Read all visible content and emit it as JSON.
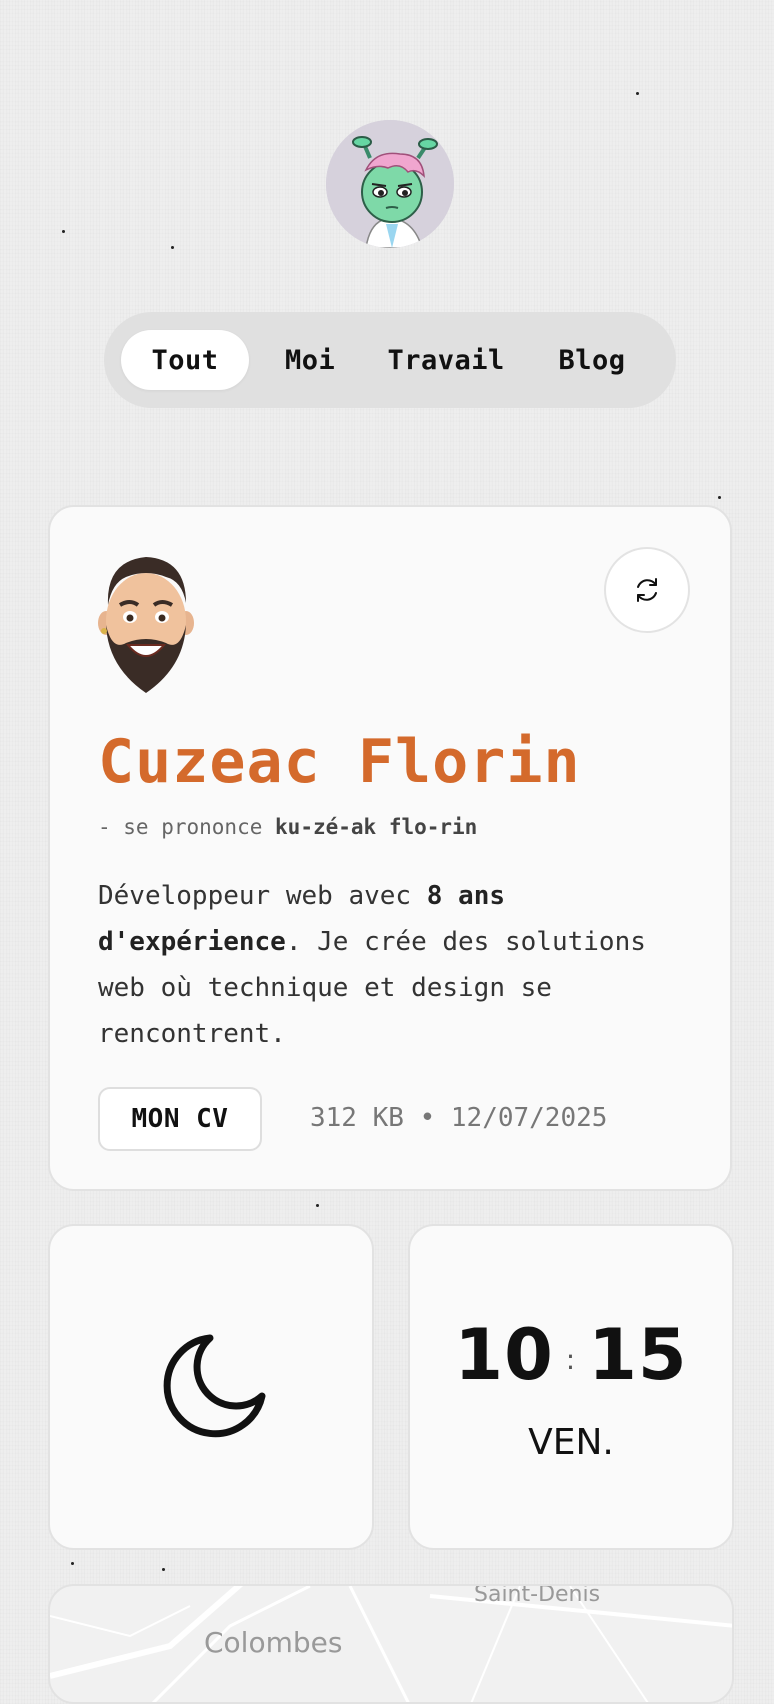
{
  "nav": {
    "tabs": [
      {
        "label": "Tout",
        "active": true
      },
      {
        "label": "Moi",
        "active": false
      },
      {
        "label": "Travail",
        "active": false
      },
      {
        "label": "Blog",
        "active": false
      }
    ]
  },
  "profile": {
    "name": "Cuzeac Florin",
    "pronunciation_prefix": "- se prononce",
    "pronunciation": "ku-zé-ak flo-rin",
    "bio_intro": "Développeur web avec ",
    "bio_highlight": "8 ans d'expérience",
    "bio_rest": ". Je crée des solutions web où technique et design se rencontrent.",
    "cv_label": "MON CV",
    "cv_size": "312 KB",
    "cv_separator": "•",
    "cv_date": "12/07/2025"
  },
  "clock": {
    "hours": "10",
    "separator": ":",
    "minutes": "15",
    "day": "VEN."
  },
  "map": {
    "labels": [
      "Colombes",
      "Saint-Denis"
    ]
  },
  "icons": {
    "refresh": "refresh-icon",
    "theme": "moon-icon"
  },
  "colors": {
    "accent": "#d46a2c",
    "background": "#eeeeee",
    "card": "#fafafa"
  }
}
